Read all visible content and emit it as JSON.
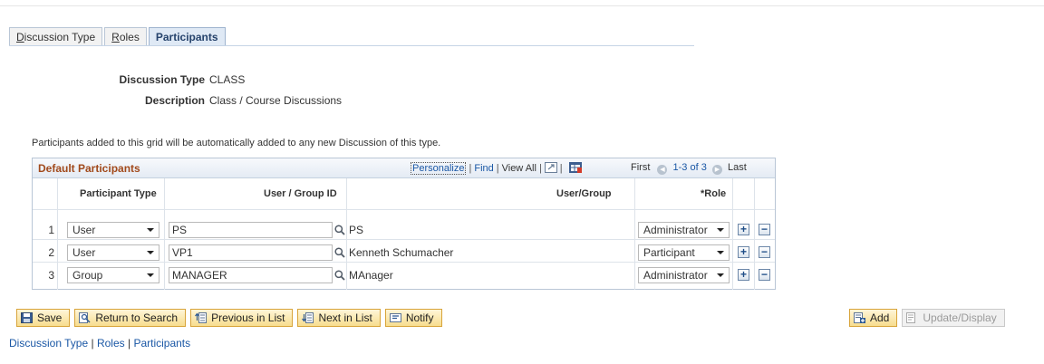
{
  "tabs": [
    {
      "prefix": "",
      "underlined": "D",
      "rest": "iscussion Type"
    },
    {
      "prefix": "",
      "underlined": "R",
      "rest": "oles"
    },
    {
      "label": "Participants"
    }
  ],
  "header": {
    "discussion_type_label": "Discussion Type",
    "discussion_type_value": "CLASS",
    "description_label": "Description",
    "description_value": "Class / Course Discussions"
  },
  "note": "Participants added to this grid will be automatically added to any new Discussion of this type.",
  "grid": {
    "title": "Default Participants",
    "personalize": "Personalize",
    "find": "Find",
    "view_all": "View All",
    "first": "First",
    "range": "1-3 of 3",
    "last": "Last",
    "columns": {
      "participant_type": "Participant Type",
      "user_group_id": "User / Group ID",
      "user_group": "User/Group",
      "role": "*Role"
    },
    "rows": [
      {
        "num": "1",
        "type": "User",
        "id": "PS",
        "name": "PS",
        "role": "Administrator"
      },
      {
        "num": "2",
        "type": "User",
        "id": "VP1",
        "name": "Kenneth Schumacher",
        "role": "Participant"
      },
      {
        "num": "3",
        "type": "Group",
        "id": "MANAGER",
        "name": "MAnager",
        "role": "Administrator"
      }
    ],
    "add_symbol": "+",
    "delete_symbol": "−"
  },
  "toolbar": {
    "save": "Save",
    "return_to_search": "Return to Search",
    "previous_in_list": "Previous in List",
    "next_in_list": "Next in List",
    "notify": "Notify",
    "add": "Add",
    "update_display": "Update/Display"
  },
  "footer_links": {
    "discussion_type": "Discussion Type",
    "roles": "Roles",
    "participants": "Participants",
    "separator": " | "
  },
  "icons": {
    "lookup": "magnifier-icon",
    "save": "floppy-disk-icon",
    "return_to_search": "search-page-icon",
    "previous": "previous-list-icon",
    "next": "next-list-icon",
    "notify": "notify-icon",
    "add": "add-page-icon",
    "update": "update-page-icon",
    "zoom": "zoom-icon",
    "download": "download-grid-icon",
    "first_arrow": "first-arrow-icon",
    "last_arrow": "last-arrow-icon"
  },
  "colors": {
    "grid_title": "#a1491b",
    "link": "#1a57a5",
    "active_tab_text": "#26436c"
  }
}
